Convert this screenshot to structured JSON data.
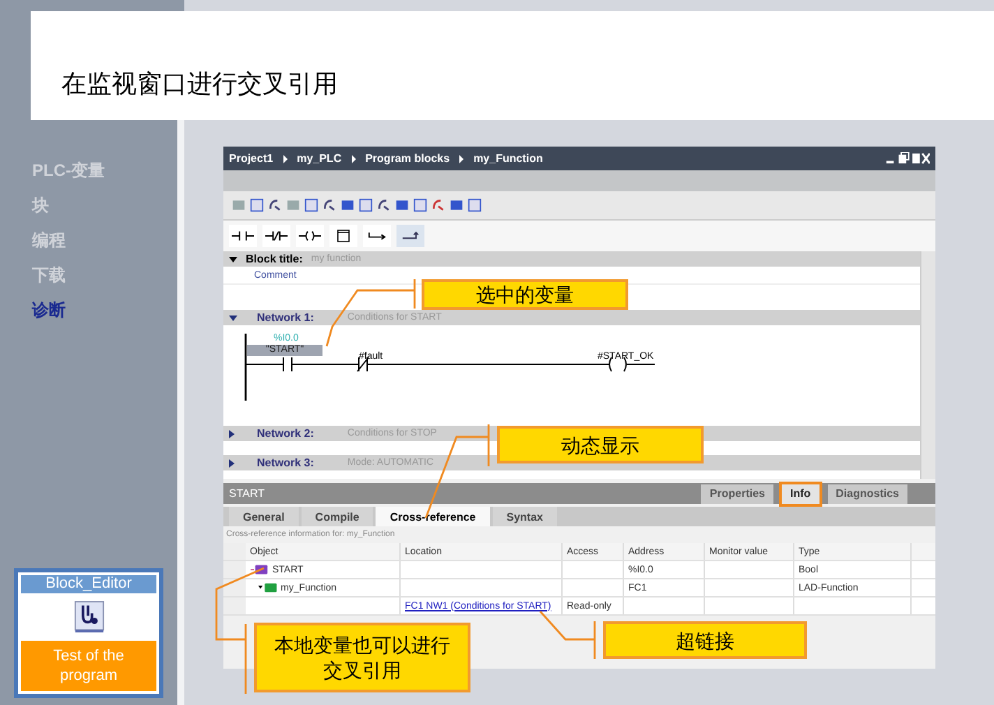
{
  "header": {
    "title": "在监视窗口进行交叉引用"
  },
  "nav": [
    {
      "label": "PLC-变量",
      "selected": false
    },
    {
      "label": "块",
      "selected": false
    },
    {
      "label": "编程",
      "selected": false
    },
    {
      "label": "下载",
      "selected": false
    },
    {
      "label": "诊断",
      "selected": true
    }
  ],
  "card": {
    "title": "Block_Editor",
    "action": "Test of the program"
  },
  "editor": {
    "breadcrumb": [
      "Project1",
      "my_PLC",
      "Program blocks",
      "my_Function"
    ],
    "block_title": {
      "label": "Block title:",
      "value": "my function"
    },
    "comment": "Comment",
    "networks": [
      {
        "label": "Network 1:",
        "title": "Conditions for START",
        "expanded": true
      },
      {
        "label": "Network 2:",
        "title": "Conditions for STOP",
        "expanded": false
      },
      {
        "label": "Network 3:",
        "title": "Mode: AUTOMATIC",
        "expanded": false
      }
    ],
    "ladder": {
      "address": "%I0.0",
      "contact_1": "\"START\"",
      "contact_2": "#fault",
      "coil": "#START_OK"
    }
  },
  "inspector": {
    "object": "START",
    "tabs": [
      {
        "label": "Properties",
        "selected": false
      },
      {
        "label": "Info",
        "selected": true
      },
      {
        "label": "Diagnostics",
        "selected": false
      }
    ],
    "subtabs": [
      {
        "label": "General",
        "selected": false
      },
      {
        "label": "Compile",
        "selected": false
      },
      {
        "label": "Cross-reference",
        "selected": true
      },
      {
        "label": "Syntax",
        "selected": false
      }
    ],
    "caption": "Cross-reference information for: my_Function",
    "columns": [
      "Object",
      "Location",
      "Access",
      "Address",
      "Monitor value",
      "Type"
    ],
    "rows": [
      {
        "kind": "tag",
        "object": "START",
        "address": "%I0.0",
        "type": "Bool"
      },
      {
        "kind": "block",
        "object": "my_Function",
        "address": "FC1",
        "type": "LAD-Function"
      },
      {
        "kind": "reference",
        "location": "FC1 NW1 (Conditions for START)",
        "access": "Read-only"
      }
    ]
  },
  "callouts": [
    {
      "text": "选中的变量"
    },
    {
      "text": "动态显示"
    },
    {
      "text": "超链接"
    },
    {
      "text": "本地变量也可以进行交叉引用"
    }
  ]
}
